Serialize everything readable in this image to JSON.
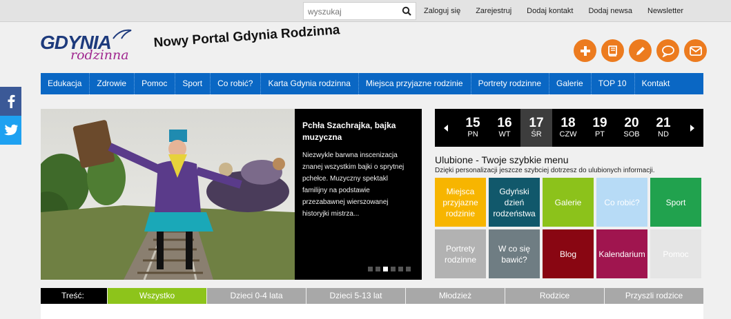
{
  "search": {
    "placeholder": "wyszukaj",
    "icon": "search-icon"
  },
  "toplinks": [
    "Zaloguj się",
    "Zarejestruj",
    "Dodaj kontakt",
    "Dodaj newsa",
    "Newsletter"
  ],
  "logo": {
    "main": "GDYNIA",
    "sub": "rodzinna"
  },
  "slogan": "Nowy Portal Gdynia Rodzinna",
  "actions": [
    "plus-icon",
    "book-icon",
    "pencil-icon",
    "speech-bubble-icon",
    "envelope-icon"
  ],
  "social": [
    "facebook-icon",
    "twitter-icon"
  ],
  "nav": [
    "Edukacja",
    "Zdrowie",
    "Pomoc",
    "Sport",
    "Co robić?",
    "Karta Gdynia rodzinna",
    "Miejsca przyjazne rodzinie",
    "Portrety rodzinne",
    "Galerie",
    "TOP 10",
    "Kontakt"
  ],
  "slider": {
    "title": "Pchła Szachrajka, bajka muzyczna",
    "text": "Niezwykle barwna inscenizacja znanej wszystkim bajki o sprytnej pchełce. Muzyczny spektakl familijny na podstawie przezabawnej wierszowanej historyjki mistrza...",
    "dots": 6,
    "active_dot": 2
  },
  "calendar": {
    "days": [
      {
        "num": "15",
        "wd": "PN"
      },
      {
        "num": "16",
        "wd": "WT"
      },
      {
        "num": "17",
        "wd": "ŚR"
      },
      {
        "num": "18",
        "wd": "CZW"
      },
      {
        "num": "19",
        "wd": "PT"
      },
      {
        "num": "20",
        "wd": "SOB"
      },
      {
        "num": "21",
        "wd": "ND"
      }
    ],
    "active_index": 2
  },
  "favorites": {
    "title": "Ulubione - Twoje szybkie menu",
    "subtitle": "Dzięki personalizacji jeszcze szybciej dotrzesz do ulubionych informacji.",
    "tiles": [
      {
        "label": "Miejsca przyjazne rodzinie",
        "color": "#f7b500"
      },
      {
        "label": "Gdyński dzień rodzeństwa",
        "color": "#11586b"
      },
      {
        "label": "Galerie",
        "color": "#8cc21b"
      },
      {
        "label": "Co robić?",
        "color": "#b7dbf6"
      },
      {
        "label": "Sport",
        "color": "#21a24e"
      },
      {
        "label": "Portrety rodzinne",
        "color": "#b2b2b2"
      },
      {
        "label": "W co się bawić?",
        "color": "#6f7d83"
      },
      {
        "label": "Blog",
        "color": "#890612"
      },
      {
        "label": "Kalendarium",
        "color": "#a0154f"
      },
      {
        "label": "Pomoc",
        "color": "#e5e5e5"
      }
    ]
  },
  "content_tabs": {
    "label": "Treść:",
    "tabs": [
      "Wszystko",
      "Dzieci 0-4 lata",
      "Dzieci 5-13 lat",
      "Młodzież",
      "Rodzice",
      "Przyszli rodzice"
    ],
    "active_index": 0
  },
  "colors": {
    "accent_orange": "#ec7b1f",
    "nav_blue": "#0a67c4",
    "tab_active": "#8dc41b"
  }
}
